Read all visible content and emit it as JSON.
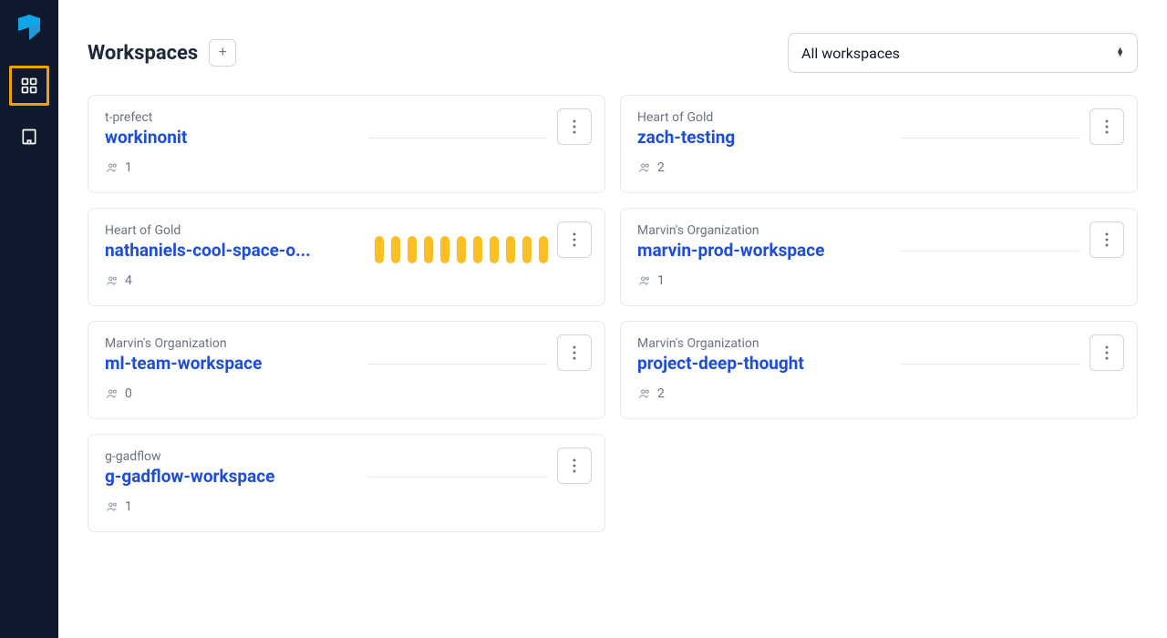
{
  "header": {
    "title": "Workspaces",
    "filter_label": "All workspaces"
  },
  "workspaces": [
    {
      "org": "t-prefect",
      "name": "workinonit",
      "members": "1",
      "bars": false
    },
    {
      "org": "Heart of Gold",
      "name": "zach-testing",
      "members": "2",
      "bars": false
    },
    {
      "org": "Heart of Gold",
      "name": "nathaniels-cool-space-o...",
      "members": "4",
      "bars": true
    },
    {
      "org": "Marvin's Organization",
      "name": "marvin-prod-workspace",
      "members": "1",
      "bars": false
    },
    {
      "org": "Marvin's Organization",
      "name": "ml-team-workspace",
      "members": "0",
      "bars": false
    },
    {
      "org": "Marvin's Organization",
      "name": "project-deep-thought",
      "members": "2",
      "bars": false
    },
    {
      "org": "g-gadflow",
      "name": "g-gadflow-workspace",
      "members": "1",
      "bars": false
    }
  ]
}
